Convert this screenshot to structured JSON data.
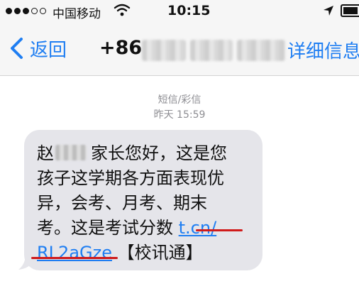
{
  "status_bar": {
    "carrier": "中国移动",
    "time": "10:15",
    "battery_level": 0.9,
    "signal_dots_filled": 3,
    "signal_dots_total": 5
  },
  "nav": {
    "back_label": "返回",
    "phone_prefix": "+86",
    "details_label": "详细信息"
  },
  "message": {
    "type_label": "短信/彩信",
    "timestamp": "昨天 15:59",
    "surname": "赵",
    "line1_rest": "家长您好，这是您",
    "line2": "孩子这学期各方面表现优",
    "line3": "异，会考、月考、期末",
    "line4_text": "考。这是考试分数 ",
    "link_part1": "t.cn/",
    "link_part2": "RL2aGze",
    "line5_suffix": " 【校讯通】"
  },
  "colors": {
    "accent_blue": "#1f7ef2",
    "bubble_gray": "#e5e5ea",
    "annotation_red": "#d01a1a"
  }
}
